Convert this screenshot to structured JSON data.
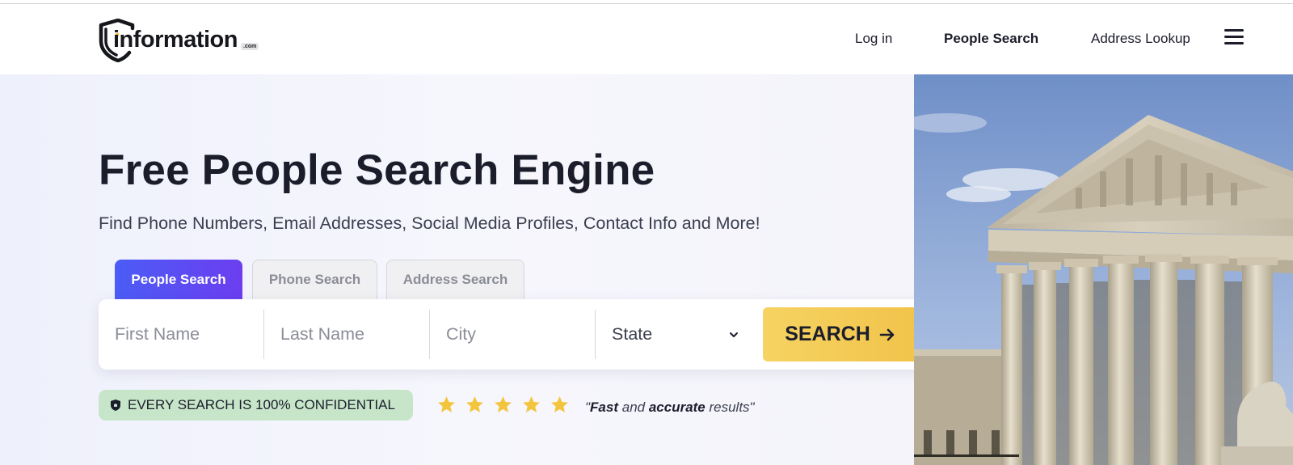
{
  "brand": {
    "logo_text": "information",
    "logo_suffix": ".com",
    "logo_icon": "shield-icon"
  },
  "nav": {
    "login": "Log in",
    "people_search": "People Search",
    "address_lookup": "Address Lookup",
    "menu_icon": "hamburger-menu-icon"
  },
  "hero": {
    "title": "Free People Search Engine",
    "subtitle": "Find Phone Numbers, Email Addresses, Social Media Profiles, Contact Info and More!"
  },
  "tabs": [
    {
      "label": "People Search",
      "active": true
    },
    {
      "label": "Phone Search",
      "active": false
    },
    {
      "label": "Address Search",
      "active": false
    }
  ],
  "search": {
    "first_name_placeholder": "First Name",
    "last_name_placeholder": "Last Name",
    "city_placeholder": "City",
    "state_selected": "State",
    "button_label": "SEARCH"
  },
  "trust": {
    "badge_text": "EVERY SEARCH IS 100% CONFIDENTIAL",
    "rating": 5,
    "rating_max": 5,
    "review_open_quote": "\"",
    "review_word1": "Fast",
    "review_and": " and ",
    "review_word2": "accurate",
    "review_tail": " results\""
  },
  "colors": {
    "accent_gradient_start": "#4b5cf5",
    "accent_gradient_end": "#6c3ef0",
    "search_button": "#f3c94f",
    "badge_bg": "#c7e6c9",
    "star": "#f3c53d",
    "text_dark": "#1b1d2b"
  }
}
